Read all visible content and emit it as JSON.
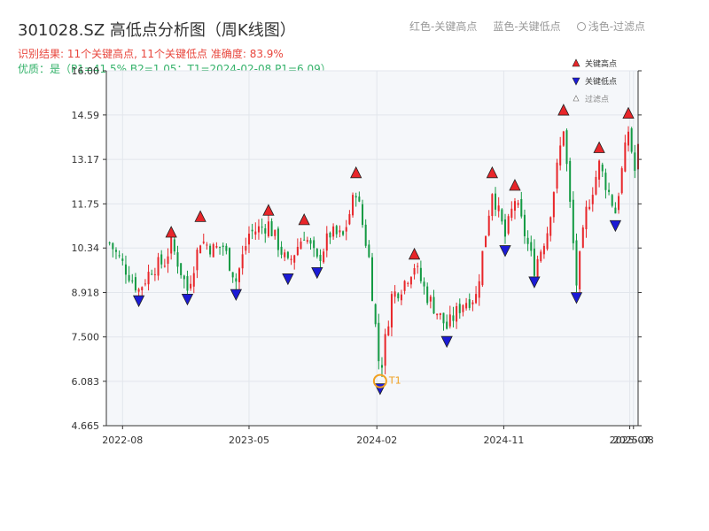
{
  "header": {
    "title": "301028.SZ 高低点分析图（周K线图）",
    "result": "识别结果: 11个关键高点, 11个关键低点   准确度: 83.9%",
    "quality": "优质：是（P1=41.5%  B2=1.05；T1=2024-02-08 P1=6.09）"
  },
  "top_legend": {
    "red": "红色-关键高点",
    "blue": "蓝色-关键低点",
    "light": "浅色-过滤点"
  },
  "colors": {
    "up": "#e8262a",
    "down": "#139a43",
    "high_marker": "#e8262a",
    "low_marker": "#1b1bd6",
    "t1": "#f0a020",
    "plot_bg": "#f5f7fa",
    "grid": "#e2e6ec"
  },
  "chart_data": {
    "type": "candlestick",
    "ylim": [
      4.665,
      16.0
    ],
    "yticks": [
      "4.665",
      "6.083",
      "7.500",
      "8.918",
      "10.34",
      "11.75",
      "13.17",
      "14.59",
      "16.00"
    ],
    "xlim": [
      "2022-06-27",
      "2025-08-18"
    ],
    "xticks": [
      {
        "date": "2022-08-01",
        "label": "2022-08"
      },
      {
        "date": "2023-05-01",
        "label": "2023-05"
      },
      {
        "date": "2024-02-01",
        "label": "2024-02"
      },
      {
        "date": "2024-11-01",
        "label": "2024-11"
      },
      {
        "date": "2025-07-31",
        "label": "2025-07"
      },
      {
        "date": "2025-08-08",
        "label": "2025-08"
      }
    ],
    "legend": [
      {
        "label": "关键高点",
        "kind": "high"
      },
      {
        "label": "关键低点",
        "kind": "low"
      },
      {
        "label": "过滤点",
        "kind": "filtered"
      }
    ],
    "t1": {
      "label": "T1",
      "date": "2024-02-08",
      "price": 6.09
    },
    "key_highs": [
      {
        "date": "2022-11-14",
        "price": 10.6
      },
      {
        "date": "2023-01-16",
        "price": 11.1
      },
      {
        "date": "2023-06-12",
        "price": 11.3
      },
      {
        "date": "2023-08-28",
        "price": 11.0
      },
      {
        "date": "2023-12-18",
        "price": 12.5
      },
      {
        "date": "2024-04-22",
        "price": 9.9
      },
      {
        "date": "2024-10-07",
        "price": 12.5
      },
      {
        "date": "2024-11-25",
        "price": 12.1
      },
      {
        "date": "2025-03-10",
        "price": 14.5
      },
      {
        "date": "2025-05-26",
        "price": 13.3
      },
      {
        "date": "2025-07-28",
        "price": 14.4
      }
    ],
    "key_lows": [
      {
        "date": "2022-09-05",
        "price": 8.9
      },
      {
        "date": "2022-12-19",
        "price": 8.95
      },
      {
        "date": "2023-04-03",
        "price": 9.1
      },
      {
        "date": "2023-07-24",
        "price": 9.6
      },
      {
        "date": "2023-09-25",
        "price": 9.8
      },
      {
        "date": "2024-07-01",
        "price": 7.6
      },
      {
        "date": "2024-11-04",
        "price": 10.5
      },
      {
        "date": "2025-01-06",
        "price": 9.5
      },
      {
        "date": "2025-04-07",
        "price": 9.0
      },
      {
        "date": "2025-06-30",
        "price": 11.3
      },
      {
        "date": "2024-02-08",
        "price": 6.09
      }
    ],
    "path": [
      [
        "2022-07-04",
        10.5
      ],
      [
        "2022-07-25",
        10.0
      ],
      [
        "2022-08-15",
        9.5
      ],
      [
        "2022-09-05",
        9.0
      ],
      [
        "2022-10-03",
        9.7
      ],
      [
        "2022-10-31",
        9.9
      ],
      [
        "2022-11-14",
        10.5
      ],
      [
        "2022-12-19",
        9.0
      ],
      [
        "2023-01-16",
        10.6
      ],
      [
        "2023-02-13",
        10.3
      ],
      [
        "2023-03-06",
        10.4
      ],
      [
        "2023-04-03",
        9.3
      ],
      [
        "2023-05-01",
        10.8
      ],
      [
        "2023-06-12",
        11.1
      ],
      [
        "2023-07-24",
        9.8
      ],
      [
        "2023-08-28",
        10.8
      ],
      [
        "2023-09-25",
        9.9
      ],
      [
        "2023-10-23",
        10.8
      ],
      [
        "2023-11-20",
        10.7
      ],
      [
        "2023-12-18",
        12.2
      ],
      [
        "2024-01-15",
        10.0
      ],
      [
        "2024-02-08",
        6.3
      ],
      [
        "2024-03-04",
        8.8
      ],
      [
        "2024-03-25",
        9.1
      ],
      [
        "2024-04-22",
        9.8
      ],
      [
        "2024-05-20",
        8.8
      ],
      [
        "2024-07-01",
        7.8
      ],
      [
        "2024-08-05",
        8.6
      ],
      [
        "2024-09-02",
        8.8
      ],
      [
        "2024-10-07",
        12.2
      ],
      [
        "2024-11-04",
        10.7
      ],
      [
        "2024-11-25",
        11.9
      ],
      [
        "2025-01-06",
        9.7
      ],
      [
        "2025-02-03",
        10.9
      ],
      [
        "2025-03-10",
        14.2
      ],
      [
        "2025-04-07",
        9.2
      ],
      [
        "2025-04-28",
        11.5
      ],
      [
        "2025-05-26",
        13.0
      ],
      [
        "2025-06-30",
        11.5
      ],
      [
        "2025-07-28",
        14.1
      ],
      [
        "2025-08-11",
        12.8
      ],
      [
        "2025-08-18",
        13.5
      ]
    ]
  }
}
